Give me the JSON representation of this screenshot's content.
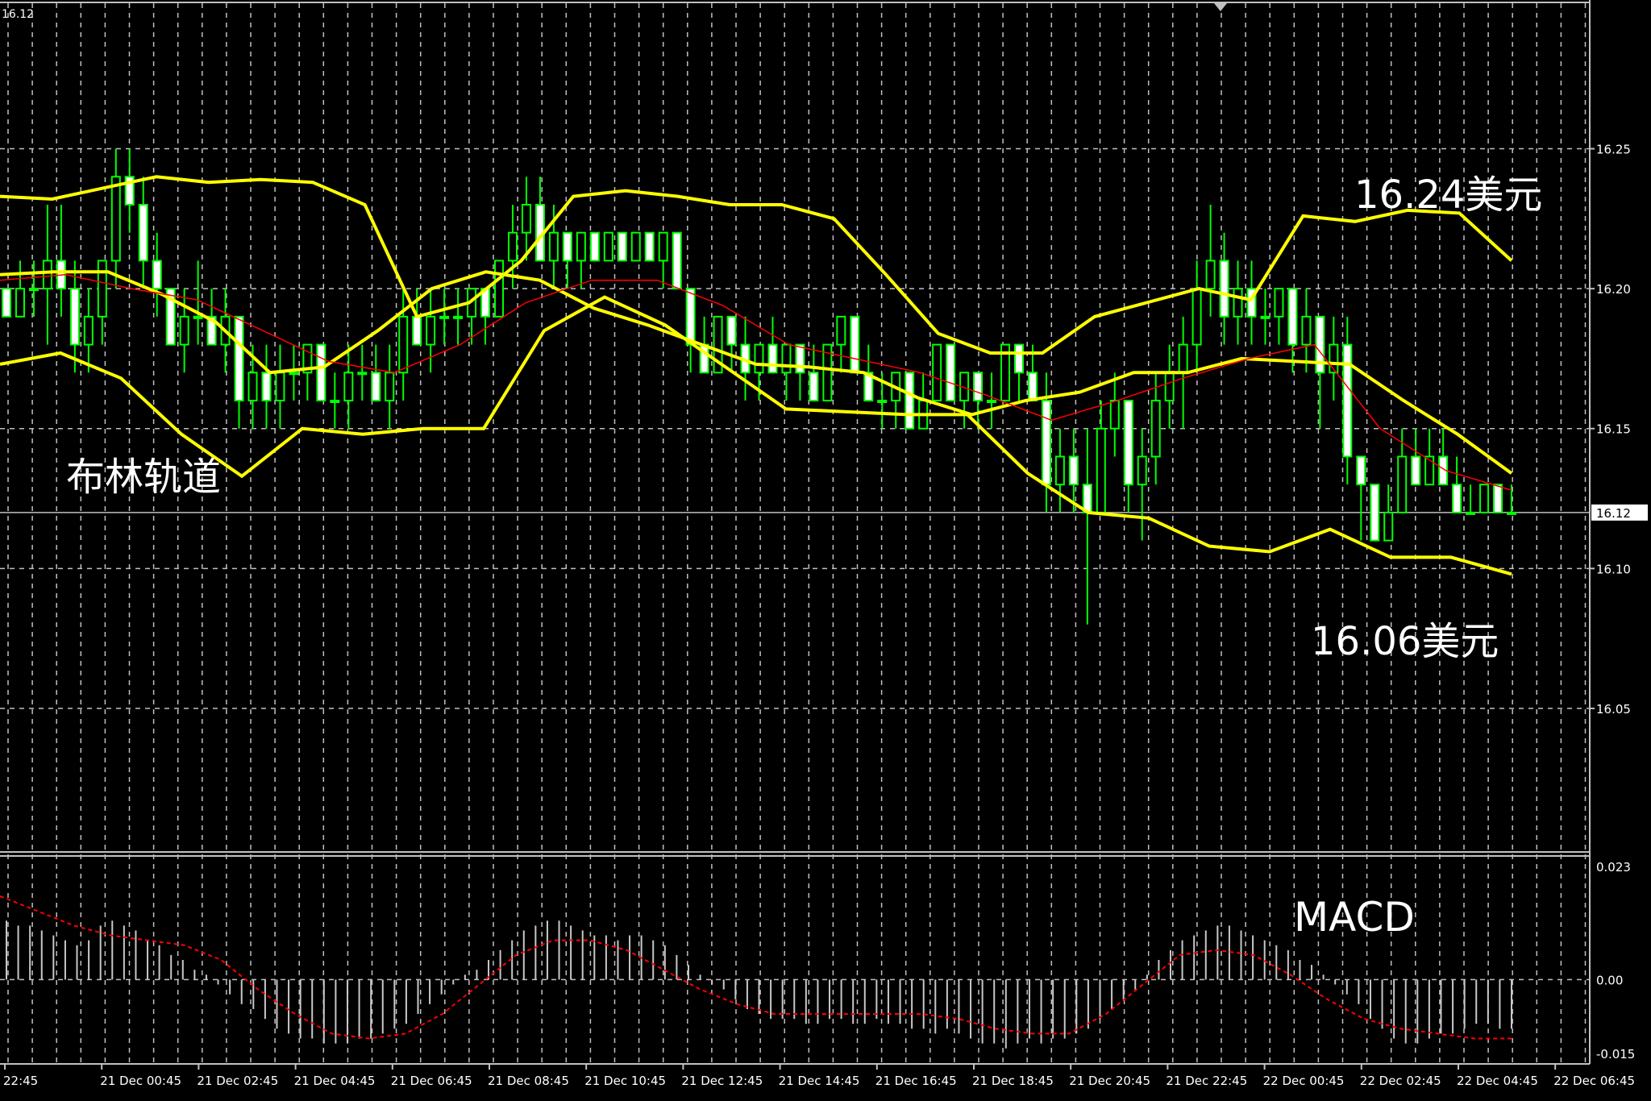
{
  "chart_data": [
    {
      "type": "candlestick",
      "pane": "price",
      "corner_label": "16.12",
      "y_ticks": [
        16.25,
        16.2,
        16.15,
        16.1,
        16.05
      ],
      "y_tick_labels": [
        "16.25",
        "16.20",
        "16.15",
        "16.10",
        "16.05"
      ],
      "ylim": [
        15.999,
        16.302
      ],
      "current_price": 16.12,
      "current_price_label": "16.12",
      "grid": true,
      "x_tick_labels": [
        "22:45",
        "21 Dec 00:45",
        "21 Dec 02:45",
        "21 Dec 04:45",
        "21 Dec 06:45",
        "21 Dec 08:45",
        "21 Dec 10:45",
        "21 Dec 12:45",
        "21 Dec 14:45",
        "21 Dec 16:45",
        "21 Dec 18:45",
        "21 Dec 20:45",
        "21 Dec 22:45",
        "22 Dec 00:45",
        "22 Dec 02:45",
        "22 Dec 04:45",
        "22 Dec 06:45"
      ],
      "annotations": [
        "16.24美元",
        "布林轨道",
        "16.06美元"
      ],
      "colors": {
        "bull": "#00ff00",
        "bear": "#ffffff",
        "body_bull": "#000000",
        "body_bear": "#ffffff",
        "bollinger": "#ffff00",
        "ma": "#ff0000",
        "grid": "#c0c0c0"
      },
      "candles": [
        [
          16.2,
          16.2,
          16.19,
          16.19
        ],
        [
          16.19,
          16.21,
          16.19,
          16.2
        ],
        [
          16.2,
          16.21,
          16.19,
          16.2
        ],
        [
          16.2,
          16.23,
          16.18,
          16.21
        ],
        [
          16.21,
          16.23,
          16.19,
          16.2
        ],
        [
          16.2,
          16.21,
          16.17,
          16.18
        ],
        [
          16.18,
          16.2,
          16.17,
          16.19
        ],
        [
          16.19,
          16.21,
          16.18,
          16.21
        ],
        [
          16.21,
          16.25,
          16.2,
          16.24
        ],
        [
          16.24,
          16.25,
          16.22,
          16.23
        ],
        [
          16.23,
          16.24,
          16.2,
          16.21
        ],
        [
          16.21,
          16.22,
          16.19,
          16.2
        ],
        [
          16.2,
          16.2,
          16.18,
          16.18
        ],
        [
          16.18,
          16.2,
          16.17,
          16.19
        ],
        [
          16.19,
          16.21,
          16.18,
          16.19
        ],
        [
          16.19,
          16.2,
          16.18,
          16.18
        ],
        [
          16.18,
          16.2,
          16.17,
          16.19
        ],
        [
          16.19,
          16.19,
          16.15,
          16.16
        ],
        [
          16.16,
          16.18,
          16.15,
          16.17
        ],
        [
          16.17,
          16.18,
          16.15,
          16.16
        ],
        [
          16.16,
          16.18,
          16.15,
          16.17
        ],
        [
          16.17,
          16.18,
          16.16,
          16.17
        ],
        [
          16.17,
          16.18,
          16.16,
          16.18
        ],
        [
          16.18,
          16.18,
          16.16,
          16.16
        ],
        [
          16.16,
          16.17,
          16.15,
          16.16
        ],
        [
          16.16,
          16.18,
          16.15,
          16.17
        ],
        [
          16.17,
          16.18,
          16.16,
          16.17
        ],
        [
          16.17,
          16.18,
          16.16,
          16.16
        ],
        [
          16.16,
          16.18,
          16.15,
          16.17
        ],
        [
          16.17,
          16.2,
          16.16,
          16.19
        ],
        [
          16.19,
          16.2,
          16.18,
          16.18
        ],
        [
          16.18,
          16.2,
          16.17,
          16.19
        ],
        [
          16.19,
          16.2,
          16.18,
          16.19
        ],
        [
          16.19,
          16.2,
          16.18,
          16.19
        ],
        [
          16.19,
          16.2,
          16.18,
          16.2
        ],
        [
          16.2,
          16.2,
          16.18,
          16.19
        ],
        [
          16.19,
          16.21,
          16.19,
          16.21
        ],
        [
          16.21,
          16.23,
          16.2,
          16.22
        ],
        [
          16.22,
          16.24,
          16.21,
          16.23
        ],
        [
          16.23,
          16.24,
          16.21,
          16.21
        ],
        [
          16.21,
          16.23,
          16.2,
          16.22
        ],
        [
          16.22,
          16.22,
          16.2,
          16.21
        ],
        [
          16.21,
          16.22,
          16.2,
          16.22
        ],
        [
          16.22,
          16.22,
          16.21,
          16.21
        ],
        [
          16.21,
          16.22,
          16.21,
          16.22
        ],
        [
          16.22,
          16.22,
          16.21,
          16.21
        ],
        [
          16.21,
          16.22,
          16.21,
          16.22
        ],
        [
          16.22,
          16.22,
          16.21,
          16.21
        ],
        [
          16.21,
          16.22,
          16.2,
          16.22
        ],
        [
          16.22,
          16.22,
          16.2,
          16.2
        ],
        [
          16.2,
          16.2,
          16.17,
          16.18
        ],
        [
          16.18,
          16.19,
          16.17,
          16.17
        ],
        [
          16.17,
          16.19,
          16.17,
          16.19
        ],
        [
          16.19,
          16.19,
          16.17,
          16.18
        ],
        [
          16.18,
          16.19,
          16.16,
          16.17
        ],
        [
          16.17,
          16.18,
          16.16,
          16.18
        ],
        [
          16.18,
          16.19,
          16.17,
          16.17
        ],
        [
          16.17,
          16.18,
          16.16,
          16.18
        ],
        [
          16.18,
          16.18,
          16.16,
          16.17
        ],
        [
          16.17,
          16.18,
          16.16,
          16.16
        ],
        [
          16.16,
          16.18,
          16.16,
          16.18
        ],
        [
          16.18,
          16.19,
          16.17,
          16.19
        ],
        [
          16.19,
          16.19,
          16.17,
          16.17
        ],
        [
          16.17,
          16.18,
          16.16,
          16.16
        ],
        [
          16.16,
          16.17,
          16.15,
          16.16
        ],
        [
          16.16,
          16.17,
          16.15,
          16.17
        ],
        [
          16.17,
          16.17,
          16.15,
          16.15
        ],
        [
          16.15,
          16.17,
          16.15,
          16.16
        ],
        [
          16.16,
          16.18,
          16.16,
          16.18
        ],
        [
          16.18,
          16.18,
          16.16,
          16.16
        ],
        [
          16.16,
          16.17,
          16.15,
          16.17
        ],
        [
          16.17,
          16.17,
          16.15,
          16.16
        ],
        [
          16.16,
          16.17,
          16.15,
          16.16
        ],
        [
          16.16,
          16.18,
          16.16,
          16.18
        ],
        [
          16.18,
          16.18,
          16.16,
          16.17
        ],
        [
          16.17,
          16.18,
          16.16,
          16.16
        ],
        [
          16.16,
          16.17,
          16.12,
          16.13
        ],
        [
          16.13,
          16.15,
          16.12,
          16.14
        ],
        [
          16.14,
          16.15,
          16.12,
          16.13
        ],
        [
          16.13,
          16.15,
          16.08,
          16.12
        ],
        [
          16.12,
          16.16,
          16.12,
          16.15
        ],
        [
          16.15,
          16.17,
          16.14,
          16.16
        ],
        [
          16.16,
          16.16,
          16.12,
          16.13
        ],
        [
          16.13,
          16.15,
          16.11,
          16.14
        ],
        [
          16.14,
          16.17,
          16.13,
          16.16
        ],
        [
          16.16,
          16.18,
          16.15,
          16.17
        ],
        [
          16.17,
          16.19,
          16.15,
          16.18
        ],
        [
          16.18,
          16.21,
          16.17,
          16.2
        ],
        [
          16.2,
          16.23,
          16.19,
          16.21
        ],
        [
          16.21,
          16.22,
          16.18,
          16.19
        ],
        [
          16.19,
          16.21,
          16.18,
          16.2
        ],
        [
          16.2,
          16.21,
          16.18,
          16.19
        ],
        [
          16.19,
          16.2,
          16.18,
          16.19
        ],
        [
          16.19,
          16.2,
          16.18,
          16.2
        ],
        [
          16.2,
          16.2,
          16.17,
          16.18
        ],
        [
          16.18,
          16.2,
          16.17,
          16.19
        ],
        [
          16.19,
          16.19,
          16.15,
          16.17
        ],
        [
          16.17,
          16.19,
          16.16,
          16.18
        ],
        [
          16.18,
          16.19,
          16.13,
          16.14
        ],
        [
          16.14,
          16.14,
          16.11,
          16.13
        ],
        [
          16.13,
          16.13,
          16.11,
          16.11
        ],
        [
          16.11,
          16.13,
          16.11,
          16.12
        ],
        [
          16.12,
          16.15,
          16.12,
          16.14
        ],
        [
          16.14,
          16.15,
          16.13,
          16.13
        ],
        [
          16.13,
          16.15,
          16.13,
          16.14
        ],
        [
          16.14,
          16.15,
          16.13,
          16.13
        ],
        [
          16.13,
          16.14,
          16.12,
          16.12
        ],
        [
          16.12,
          16.13,
          16.12,
          16.12
        ],
        [
          16.12,
          16.13,
          16.12,
          16.13
        ],
        [
          16.13,
          16.13,
          16.12,
          16.12
        ],
        [
          16.12,
          16.13,
          16.12,
          16.12
        ]
      ],
      "bollinger": {
        "upper": [
          16.233,
          16.232,
          16.236,
          16.24,
          16.238,
          16.239,
          16.238,
          16.23,
          16.19,
          16.195,
          16.21,
          16.233,
          16.235,
          16.233,
          16.23,
          16.23,
          16.225,
          16.205,
          16.184,
          16.177,
          16.177,
          16.19,
          16.195,
          16.2,
          16.196,
          16.226,
          16.224,
          16.228,
          16.227,
          16.21
        ],
        "middle": [
          16.205,
          16.206,
          16.206,
          16.198,
          16.188,
          16.17,
          16.172,
          16.185,
          16.2,
          16.206,
          16.203,
          16.193,
          16.187,
          16.18,
          16.173,
          16.172,
          16.17,
          16.161,
          16.155,
          16.16,
          16.163,
          16.17,
          16.17,
          16.175,
          16.174,
          16.173,
          16.16,
          16.148,
          16.134
        ],
        "lower": [
          16.173,
          16.177,
          16.168,
          16.148,
          16.133,
          16.15,
          16.148,
          16.15,
          16.15,
          16.185,
          16.197,
          16.187,
          16.172,
          16.157,
          16.156,
          16.155,
          16.155,
          16.134,
          16.12,
          16.118,
          16.108,
          16.106,
          16.114,
          16.104,
          16.104,
          16.098
        ]
      },
      "ma": [
        16.203,
        16.205,
        16.2,
        16.196,
        16.185,
        16.174,
        16.17,
        16.18,
        16.195,
        16.203,
        16.203,
        16.194,
        16.18,
        16.175,
        16.17,
        16.162,
        16.153,
        16.16,
        16.168,
        16.175,
        16.18,
        16.15,
        16.135,
        16.128
      ]
    },
    {
      "type": "bar",
      "pane": "MACD",
      "title": "MACD",
      "y_ticks": [
        0.023,
        0.0,
        -0.015
      ],
      "y_tick_labels": [
        "0.023",
        "0.00",
        "-0.015"
      ],
      "ylim": [
        -0.017,
        0.025
      ],
      "colors": {
        "histogram": "#c8c8c8",
        "signal": "#ff0000"
      },
      "histogram": [
        0.012,
        0.011,
        0.011,
        0.01,
        0.009,
        0.008,
        0.007,
        0.008,
        0.011,
        0.012,
        0.011,
        0.01,
        0.008,
        0.007,
        0.005,
        0.004,
        0.002,
        0.001,
        -0.001,
        -0.003,
        -0.005,
        -0.006,
        -0.008,
        -0.01,
        -0.011,
        -0.012,
        -0.012,
        -0.013,
        -0.013,
        -0.013,
        -0.012,
        -0.012,
        -0.011,
        -0.01,
        -0.009,
        -0.007,
        -0.005,
        -0.003,
        -0.001,
        0.001,
        0.002,
        0.004,
        0.006,
        0.008,
        0.01,
        0.011,
        0.012,
        0.012,
        0.011,
        0.01,
        0.009,
        0.009,
        0.008,
        0.009,
        0.009,
        0.008,
        0.007,
        0.005,
        0.003,
        0.001,
        -0.001,
        -0.002,
        -0.004,
        -0.006,
        -0.007,
        -0.008,
        -0.008,
        -0.008,
        -0.009,
        -0.009,
        -0.008,
        -0.008,
        -0.009,
        -0.009,
        -0.008,
        -0.009,
        -0.009,
        -0.01,
        -0.01,
        -0.011,
        -0.01,
        -0.011,
        -0.012,
        -0.013,
        -0.013,
        -0.014,
        -0.013,
        -0.012,
        -0.013,
        -0.012,
        -0.012,
        -0.011,
        -0.01,
        -0.008,
        -0.006,
        -0.004,
        -0.002,
        0.001,
        0.004,
        0.006,
        0.008,
        0.009,
        0.01,
        0.011,
        0.011,
        0.01,
        0.009,
        0.008,
        0.007,
        0.006,
        0.004,
        0.003,
        0.001,
        -0.001,
        -0.003,
        -0.005,
        -0.008,
        -0.01,
        -0.012,
        -0.013,
        -0.013,
        -0.012,
        -0.011,
        -0.011,
        -0.01,
        -0.009,
        -0.009,
        -0.01,
        -0.01
      ],
      "signal": [
        0.017,
        0.014,
        0.011,
        0.009,
        0.008,
        0.007,
        0.004,
        -0.002,
        -0.007,
        -0.011,
        -0.012,
        -0.011,
        -0.007,
        -0.001,
        0.005,
        0.008,
        0.008,
        0.006,
        0.002,
        -0.002,
        -0.005,
        -0.007,
        -0.007,
        -0.007,
        -0.007,
        -0.007,
        -0.008,
        -0.01,
        -0.011,
        -0.011,
        -0.007,
        -0.001,
        0.005,
        0.006,
        0.005,
        0.001,
        -0.004,
        -0.008,
        -0.01,
        -0.011,
        -0.012,
        -0.012
      ]
    }
  ]
}
